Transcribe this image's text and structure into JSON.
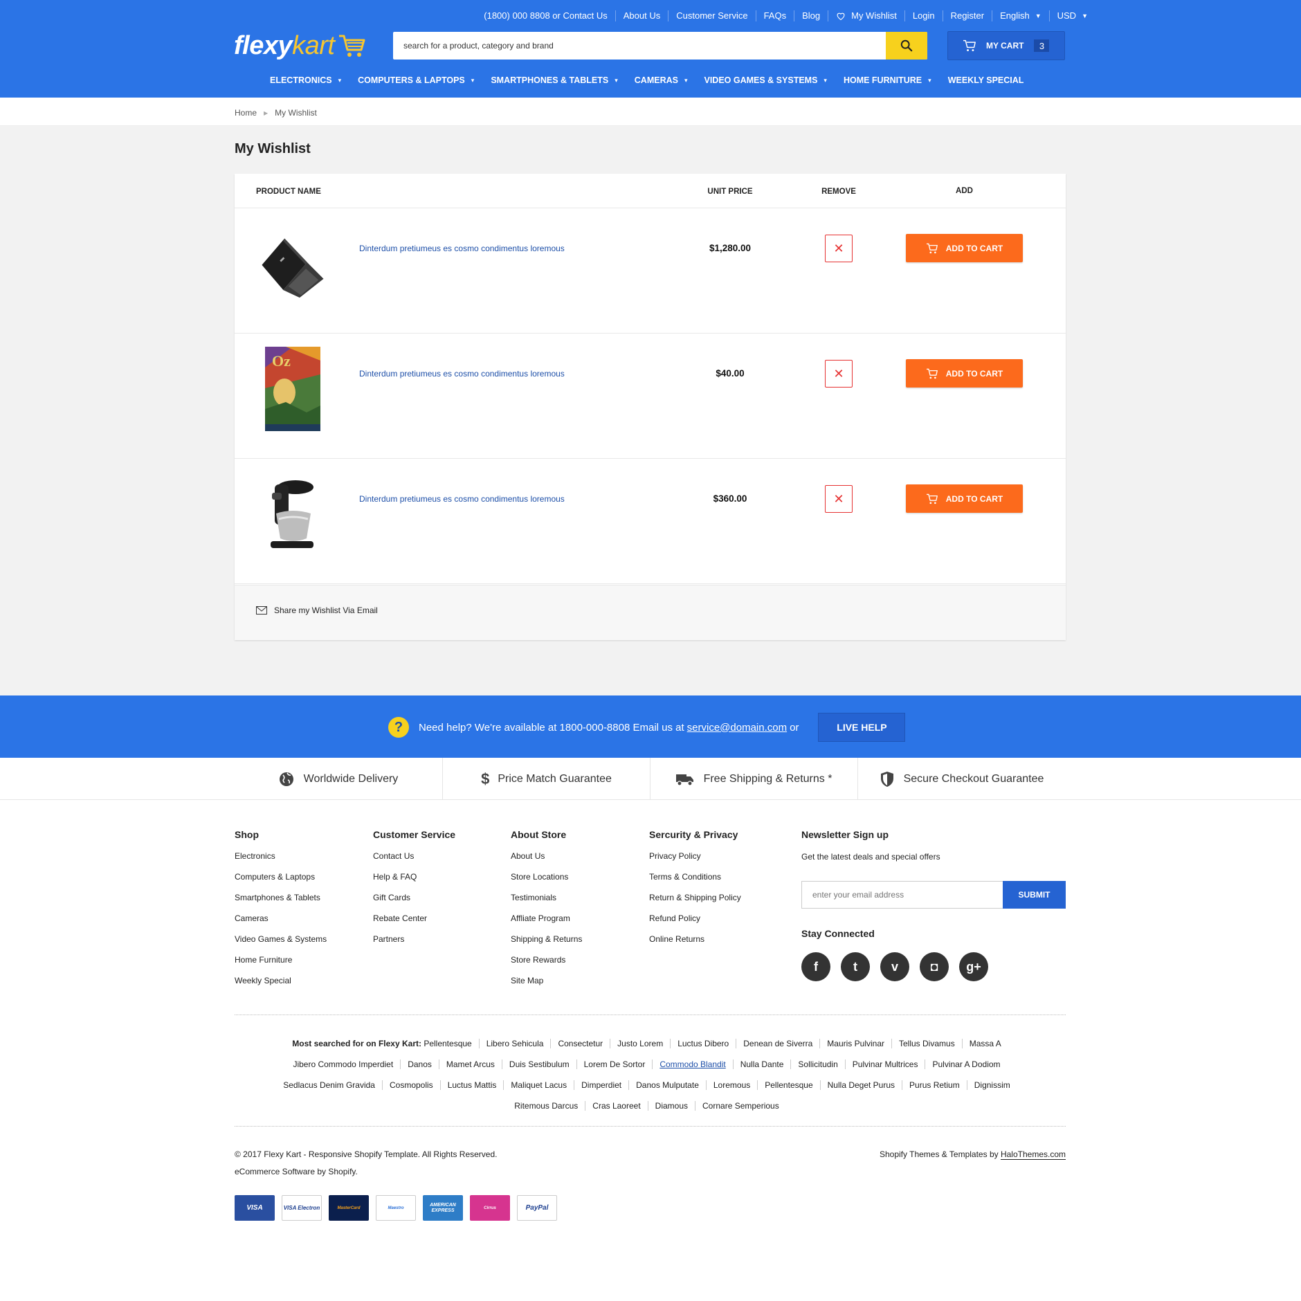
{
  "topbar": {
    "contact": "(1800) 000 8808 or Contact Us",
    "about": "About Us",
    "service": "Customer Service",
    "faqs": "FAQs",
    "blog": "Blog",
    "wishlist": "My Wishlist",
    "login": "Login",
    "register": "Register",
    "language": "English",
    "currency": "USD"
  },
  "logo": {
    "part1": "flexy",
    "part2": "kart"
  },
  "search": {
    "placeholder": "search for a product, category and brand"
  },
  "cart": {
    "label": "MY CART",
    "count": "3"
  },
  "nav": [
    {
      "label": "ELECTRONICS",
      "dropdown": true
    },
    {
      "label": "COMPUTERS & LAPTOPS",
      "dropdown": true
    },
    {
      "label": "SMARTPHONES & TABLETS",
      "dropdown": true
    },
    {
      "label": "CAMERAS",
      "dropdown": true
    },
    {
      "label": "VIDEO GAMES & SYSTEMS",
      "dropdown": true
    },
    {
      "label": "HOME FURNITURE",
      "dropdown": true
    },
    {
      "label": "WEEKLY SPECIAL",
      "dropdown": false
    }
  ],
  "breadcrumb": {
    "home": "Home",
    "current": "My Wishlist"
  },
  "page_title": "My Wishlist",
  "table": {
    "headers": {
      "product": "PRODUCT NAME",
      "price": "UNIT PRICE",
      "remove": "REMOVE",
      "add": "ADD"
    },
    "rows": [
      {
        "name": "Dinterdum pretiumeus es cosmo condimentus loremous",
        "price": "$1,280.00",
        "image": "laptop-image",
        "action": "ADD TO CART"
      },
      {
        "name": "Dinterdum pretiumeus es cosmo condimentus loremous",
        "price": "$40.00",
        "image": "book-cover-image",
        "action": "ADD TO CART"
      },
      {
        "name": "Dinterdum pretiumeus es cosmo condimentus loremous",
        "price": "$360.00",
        "image": "stand-mixer-image",
        "action": "ADD TO CART"
      }
    ],
    "share": "Share my Wishlist Via Email"
  },
  "help": {
    "text": "Need help? We're available at 1800-000-8808 Email us at",
    "email": "service@domain.com",
    "or": "or",
    "button": "LIVE HELP"
  },
  "guarantees": [
    {
      "label": "Worldwide Delivery",
      "icon": "globe-icon"
    },
    {
      "label": "Price Match Guarantee",
      "icon": "dollar-icon"
    },
    {
      "label": "Free Shipping & Returns *",
      "icon": "truck-icon"
    },
    {
      "label": "Secure Checkout Guarantee",
      "icon": "shield-icon"
    }
  ],
  "footer": {
    "shop": {
      "title": "Shop",
      "items": [
        "Electronics",
        "Computers & Laptops",
        "Smartphones & Tablets",
        "Cameras",
        "Video Games & Systems",
        "Home Furniture",
        "Weekly Special"
      ]
    },
    "customer_service": {
      "title": "Customer Service",
      "items": [
        "Contact Us",
        "Help & FAQ",
        "Gift Cards",
        "Rebate Center",
        "Partners"
      ]
    },
    "about_store": {
      "title": "About Store",
      "items": [
        "About Us",
        "Store Locations",
        "Testimonials",
        "Affliate Program",
        "Shipping & Returns",
        "Store Rewards",
        "Site Map"
      ]
    },
    "security": {
      "title": "Sercurity & Privacy",
      "items": [
        "Privacy Policy",
        "Terms & Conditions",
        "Return & Shipping Policy",
        "Refund Policy",
        "Online Returns"
      ]
    },
    "newsletter": {
      "title": "Newsletter Sign up",
      "subtitle": "Get the latest deals and special offers",
      "placeholder": "enter your email address",
      "button": "SUBMIT",
      "stay": "Stay Connected"
    },
    "social": [
      {
        "name": "facebook-icon",
        "glyph": "f"
      },
      {
        "name": "twitter-icon",
        "glyph": "t"
      },
      {
        "name": "vimeo-icon",
        "glyph": "v"
      },
      {
        "name": "instagram-icon",
        "glyph": "◘"
      },
      {
        "name": "google-plus-icon",
        "glyph": "g+"
      }
    ],
    "most_searched": {
      "label": "Most searched for on Flexy Kart:",
      "lines": [
        [
          "Pellentesque",
          "Libero Sehicula",
          "Consectetur",
          "Justo Lorem",
          "Luctus Dibero",
          "Denean de Siverra",
          "Mauris Pulvinar",
          "Tellus Divamus",
          "Massa A"
        ],
        [
          "Jibero Commodo Imperdiet",
          "Danos",
          "Mamet Arcus",
          "Duis Sestibulum",
          "Lorem De Sortor",
          "Commodo Blandit",
          "Nulla Dante",
          "Sollicitudin",
          "Pulvinar Multrices",
          "Pulvinar A Dodiom"
        ],
        [
          "Sedlacus Denim Gravida",
          "Cosmopolis",
          "Luctus Mattis",
          "Maliquet Lacus",
          "Dimperdiet",
          "Danos Mulputate",
          "Loremous",
          "Pellentesque",
          "Nulla Deget Purus",
          "Purus Retium",
          "Dignissim"
        ],
        [
          "Ritemous Darcus",
          "Cras Laoreet",
          "Diamous",
          "Cornare Semperious"
        ]
      ]
    },
    "copyright1": "© 2017 Flexy Kart - Responsive Shopify Template. All Rights Reserved.",
    "copyright2": "eCommerce Software by Shopify.",
    "credit_prefix": "Shopify Themes & Templates by",
    "credit_link": "HaloThemes.com",
    "payments": [
      "VISA",
      "VISA Electron",
      "MasterCard",
      "Maestro",
      "AMERICAN EXPRESS",
      "Cirrus",
      "PayPal"
    ]
  },
  "colors": {
    "primary": "#2b74e6",
    "accent_yellow": "#f7d11d",
    "cta_orange": "#fc6a1c",
    "remove_red": "#e63232",
    "link_blue": "#1d4fa8"
  }
}
